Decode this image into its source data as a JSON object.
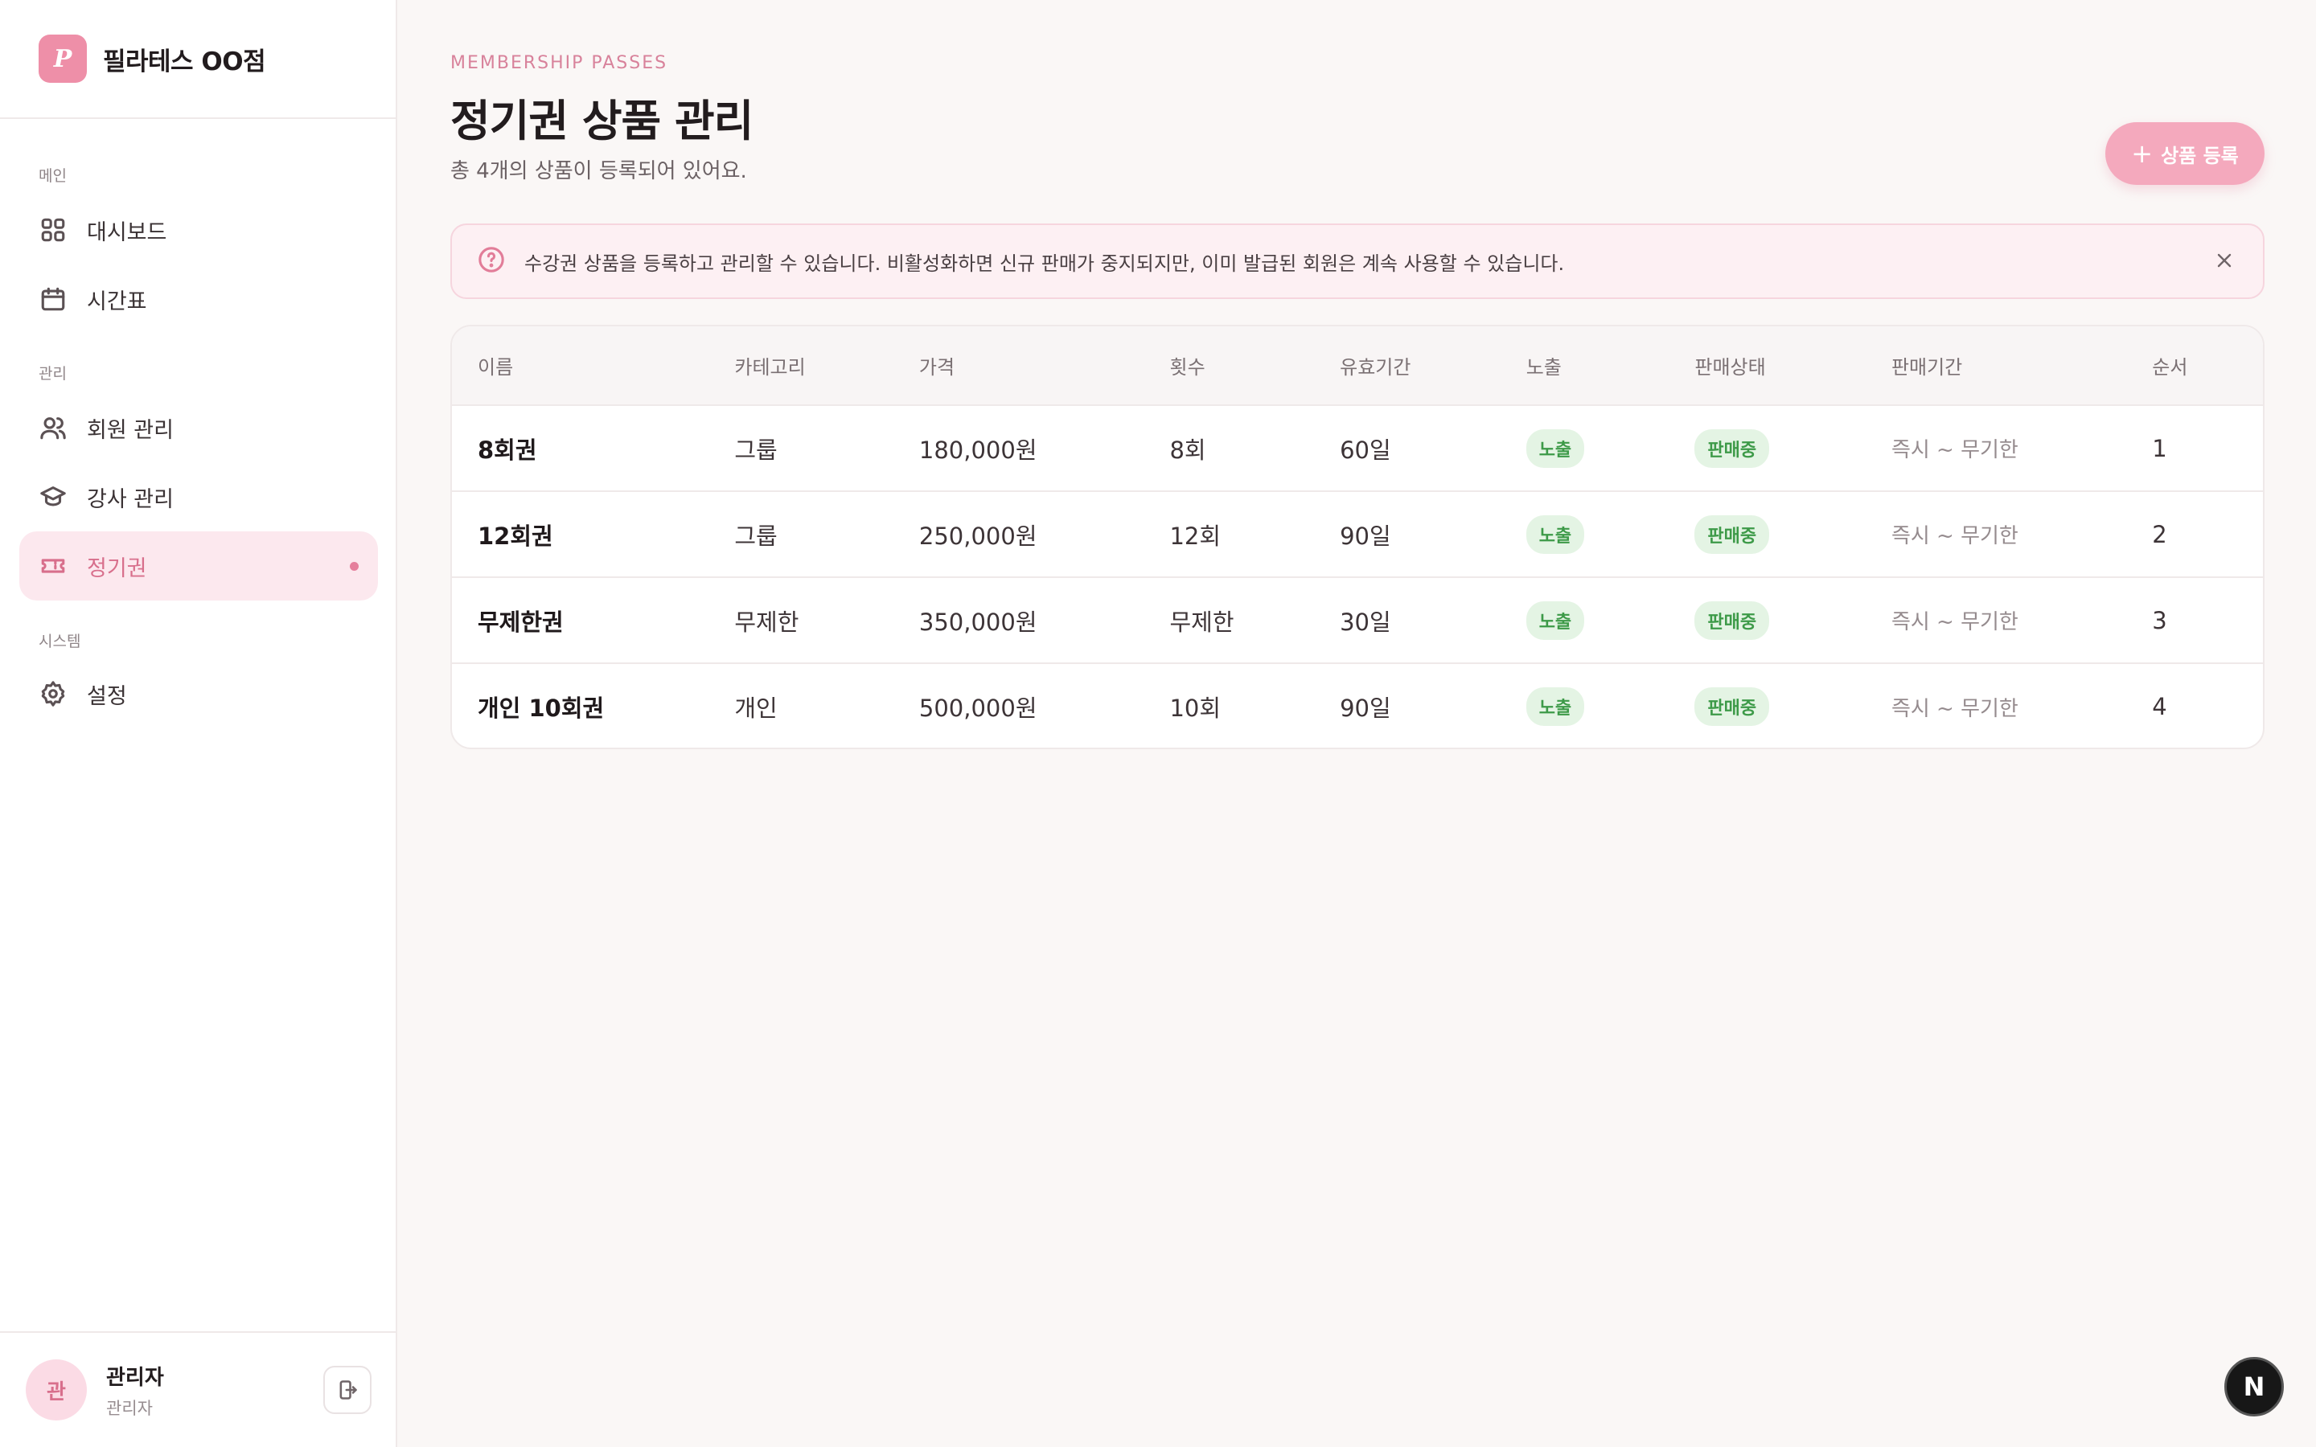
{
  "brand": {
    "logo_letter": "P",
    "name": "필라테스 OO점"
  },
  "nav": {
    "sections": [
      "메인",
      "관리",
      "시스템"
    ],
    "items": [
      {
        "label": "대시보드",
        "icon": "grid-icon"
      },
      {
        "label": "시간표",
        "icon": "calendar-icon"
      },
      {
        "label": "회원 관리",
        "icon": "users-icon"
      },
      {
        "label": "강사 관리",
        "icon": "graduation-cap-icon"
      },
      {
        "label": "정기권",
        "icon": "ticket-icon",
        "active": true
      },
      {
        "label": "설정",
        "icon": "gear-icon"
      }
    ]
  },
  "user": {
    "avatar_initial": "관",
    "name": "관리자",
    "role": "관리자"
  },
  "header": {
    "eyebrow": "MEMBERSHIP PASSES",
    "title": "정기권 상품 관리",
    "subtitle": "총 4개의 상품이 등록되어 있어요.",
    "add_button": "상품 등록"
  },
  "notice": {
    "text": "수강권 상품을 등록하고 관리할 수 있습니다. 비활성화하면 신규 판매가 중지되지만, 이미 발급된 회원은 계속 사용할 수 있습니다."
  },
  "table": {
    "headers": [
      "이름",
      "카테고리",
      "가격",
      "횟수",
      "유효기간",
      "노출",
      "판매상태",
      "판매기간",
      "순서"
    ],
    "rows": [
      {
        "name": "8회권",
        "category": "그룹",
        "price": "180,000원",
        "count": "8회",
        "validity": "60일",
        "exposure": "노출",
        "status": "판매중",
        "period": "즉시 ~ 무기한",
        "order": "1"
      },
      {
        "name": "12회권",
        "category": "그룹",
        "price": "250,000원",
        "count": "12회",
        "validity": "90일",
        "exposure": "노출",
        "status": "판매중",
        "period": "즉시 ~ 무기한",
        "order": "2"
      },
      {
        "name": "무제한권",
        "category": "무제한",
        "price": "350,000원",
        "count": "무제한",
        "validity": "30일",
        "exposure": "노출",
        "status": "판매중",
        "period": "즉시 ~ 무기한",
        "order": "3"
      },
      {
        "name": "개인 10회권",
        "category": "개인",
        "price": "500,000원",
        "count": "10회",
        "validity": "90일",
        "exposure": "노출",
        "status": "판매중",
        "period": "즉시 ~ 무기한",
        "order": "4"
      }
    ]
  },
  "colors": {
    "accent": "#f4a9bd",
    "accent_text": "#d86f8c",
    "badge_bg": "#e4f4e4",
    "badge_text": "#3d9a48"
  },
  "floating_badge": "N"
}
